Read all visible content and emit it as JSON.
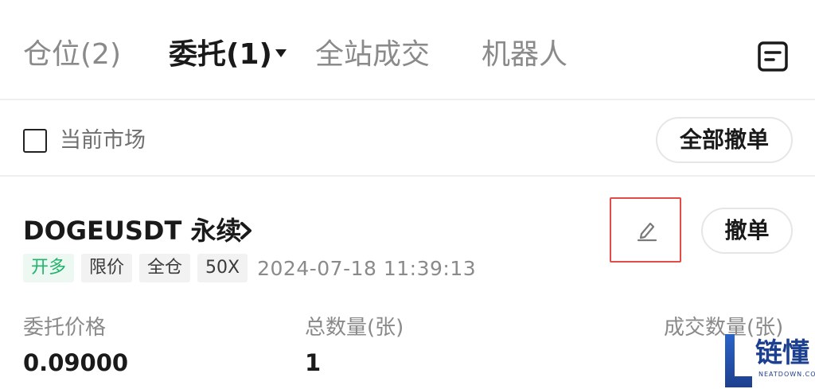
{
  "tabs": [
    {
      "label": "仓位(2)",
      "active": false
    },
    {
      "label": "委托(1)",
      "active": true
    },
    {
      "label": "全站成交",
      "active": false
    },
    {
      "label": "机器人",
      "active": false
    }
  ],
  "header": {
    "notes_icon": "notes-icon"
  },
  "filter": {
    "checkbox_label": "当前市场",
    "checked": false,
    "cancel_all_label": "全部撤单"
  },
  "order": {
    "symbol": "DOGEUSDT 永续",
    "tags": [
      "开多",
      "限价",
      "全仓",
      "50X"
    ],
    "timestamp": "2024-07-18 11:39:13",
    "cancel_label": "撤单",
    "edit_icon": "pencil-icon",
    "fields": [
      {
        "label": "委托价格",
        "value": "0.09000"
      },
      {
        "label": "总数量(张)",
        "value": "1"
      },
      {
        "label": "成交数量(张)",
        "value": ""
      }
    ]
  },
  "watermark": {
    "text": "链懂",
    "sub": "NEATDOWN.COM"
  },
  "colors": {
    "long_green": "#23b36b",
    "highlight_red": "#e34a4a",
    "watermark_blue": "#1d3f8f"
  }
}
